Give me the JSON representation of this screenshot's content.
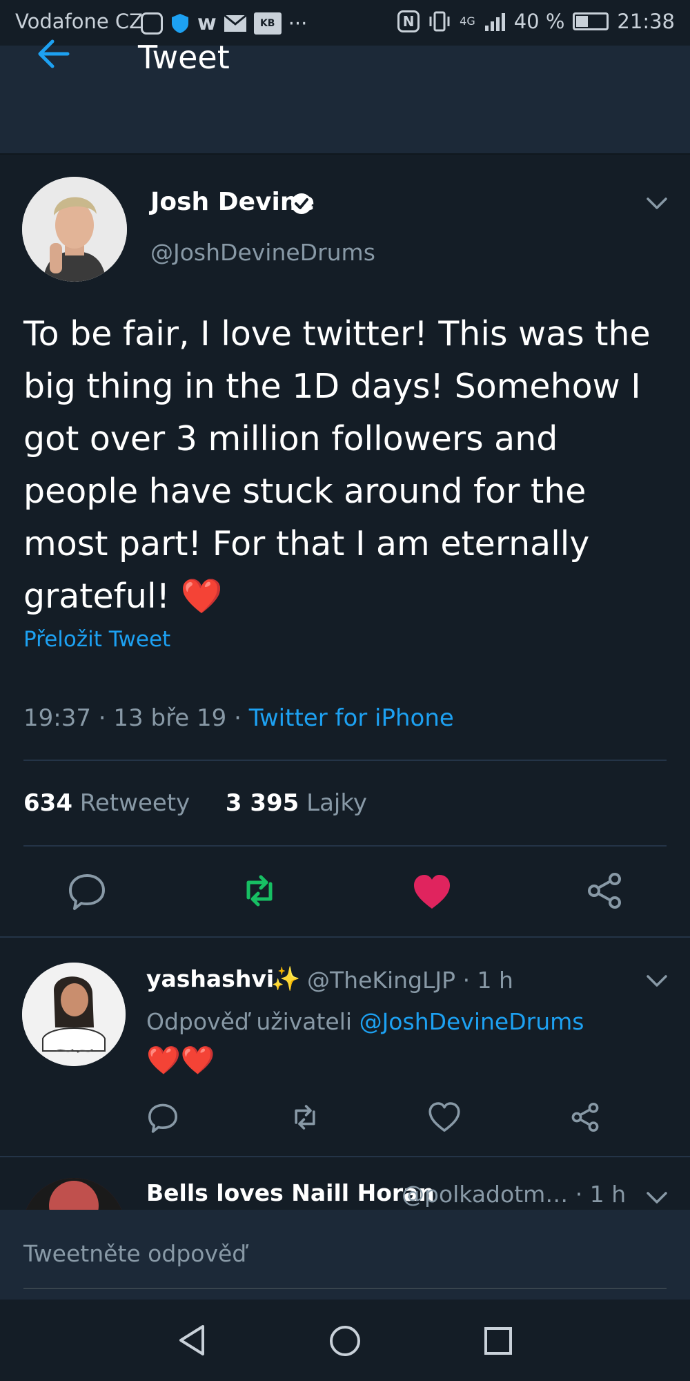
{
  "status_bar": {
    "carrier": "Vodafone CZ",
    "notif_icon_label": "KB",
    "overflow": "···",
    "network": "4G",
    "battery": "40 %",
    "battery_level": 0.4,
    "time": "21:38"
  },
  "header": {
    "title": "Tweet"
  },
  "tweet": {
    "author_name": "Josh Devine",
    "verified": true,
    "handle": "@JoshDevineDrums",
    "text": "To be fair, I love twitter! This was the big thing in the 1D days! Somehow I got over 3 million followers and people have stuck around for the most part! For that I am eternally grateful! ❤️",
    "translate_label": "Přeložit Tweet",
    "time": "19:37",
    "date": "13 bře 19",
    "source": "Twitter for iPhone",
    "separator": "·",
    "retweets_count": "634",
    "retweets_label": "Retweety",
    "likes_count": "3 395",
    "likes_label": "Lajky",
    "liked": true,
    "retweeted": true
  },
  "replies": [
    {
      "name": "yashashvi",
      "sparkle": "✨",
      "handle": "@TheKingLJP",
      "time": "· 1 h",
      "reply_to_prefix": "Odpověď uživateli",
      "reply_to_handle": "@JoshDevineDrums",
      "text": "❤️❤️"
    },
    {
      "name": "Bells loves Naill Horan",
      "handle": "@polkadotm…",
      "time": "· 1 h"
    }
  ],
  "compose": {
    "placeholder": "Tweetněte odpověď"
  },
  "colors": {
    "background": "#141d26",
    "header": "#1c2938",
    "accent": "#1da1f2",
    "like": "#e0245e",
    "retweet": "#17bf63",
    "secondary_text": "#8899a6"
  },
  "icons": [
    "back-arrow-icon",
    "verified-icon",
    "chevron-down-icon",
    "reply-icon",
    "retweet-icon",
    "like-icon",
    "share-icon"
  ]
}
